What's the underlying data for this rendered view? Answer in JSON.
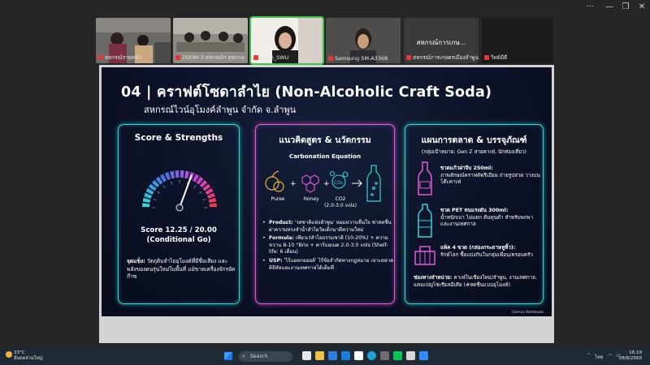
{
  "window": {
    "controls": {
      "more": "···",
      "minimize": "—",
      "maximize": "❐",
      "close": "✕"
    }
  },
  "participants": [
    {
      "name": "สหกรณ์รายหน้า",
      "type": "video"
    },
    {
      "name": "ZOOM-3 สหกรณ์ฯ สุขภาพ",
      "type": "video"
    },
    {
      "name": "บันทึก_SWU",
      "type": "video",
      "active": true
    },
    {
      "name": "Samsung SM-A336B",
      "type": "video"
    },
    {
      "name": "สหกรณ์การเกษตรเมืองลำพูน",
      "type": "name",
      "center": "สหกรณ์การเกษ..."
    },
    {
      "name": "วิทย์มีดี",
      "type": "dark"
    }
  ],
  "slide": {
    "title": "04 | คราฟต์โซดาลำไย (Non-Alcoholic Craft Soda)",
    "subtitle": "สหกรณ์ไวน์อุโมงค์ลำพูน จำกัด จ.ลำพูน",
    "cards": {
      "score": {
        "heading": "Score & Strengths",
        "score_line1": "Score 12.25 / 20.00",
        "score_line2": "(Conditional Go)",
        "gauge_value": 12.25,
        "gauge_max": 20,
        "strength_label": "จุดแข็ง:",
        "strength_text": "วัตถุดิบลำไยอุโมงค์ที่มีชื่อเสียง และพลังของคนรุ่นใหม่ในพื้นที่ แม้ขาดเครื่องจักรอัดก๊าซ"
      },
      "formula": {
        "heading": "แนวคิดสูตร & นวัตกรรม",
        "eq_title": "Carbonation Equation",
        "puree": "Puree",
        "honey": "Honey",
        "co2": "CO2",
        "co2_note": "(2.0-3.0 vols)",
        "bullets": [
          {
            "label": "Product:",
            "text": "'รสชาติแห่งลำพูน' หอมหวานชื่นใจ ซ่าสดชื่น ผ่าความทรงจำน้ำลำไยวัยเด็กมาดีความใหม่"
          },
          {
            "label": "Formula:",
            "text": "เพียวเร่ลำไยธรรมชาติ (10-20%) + ความหวาน 8-10 °Brix + คาร์บอเนต 2.0-3.0 vols (Shelf-life: 6 เดือน)"
          },
          {
            "label": "USP:",
            "text": "'ไร้แอลกอฮอล์' ไร้ข้อจำกัดทางกฎหมาย เจาะตลาดดิจิทัลและงานเทศกาลได้เต็มที่"
          }
        ]
      },
      "marketing": {
        "heading": "แผนการตลาด & บรรจุภัณฑ์",
        "target": "(กลุ่มเป้าหมาย: Gen Z สายคาเฟ่, นักท่องเที่ยว)",
        "packages": [
          {
            "title": "ขวดแก้วฝาจีบ 250ml:",
            "text": "ภาพลักษณ์คราฟต์พรีเมียม ถ่ายรูปสวย วางบนโต๊ะคาเฟ่"
          },
          {
            "title": "ขวด PET ทนแรงดัน 300ml:",
            "text": "น้ำหนักเบา ไม่แตก ต้นทุนต่ำ สำหรับพกพาและงานเทศกาล"
          },
          {
            "title": "แพ็ค 4 ขวด (กล่องกระดาษหูหิ้ว):",
            "text": "รักษ์โลก ซื้อแบ่งกันในกลุ่มเพื่อน/ครอบครัว"
          }
        ],
        "channel_label": "ช่องทางจำหน่าย:",
        "channel_text": "คาเฟ่ในเชียงใหม่/ลำพูน, งานเทศกาล, แคมเปญโซเชียลมีเดีย (#สดชื่นแบบอุโมงค์)"
      }
    },
    "watermark": "Gemini Notebook"
  },
  "taskbar": {
    "weather_temp": "33°C",
    "weather_desc": "มีแดดส่วนใหญ่",
    "search_placeholder": "Search",
    "time": "16:19",
    "date": "28/8/2569",
    "lang": "ไทย"
  },
  "colors": {
    "cyan": "#37d6d6",
    "magenta": "#e35bd9",
    "slide_bg": "#0c1228"
  }
}
